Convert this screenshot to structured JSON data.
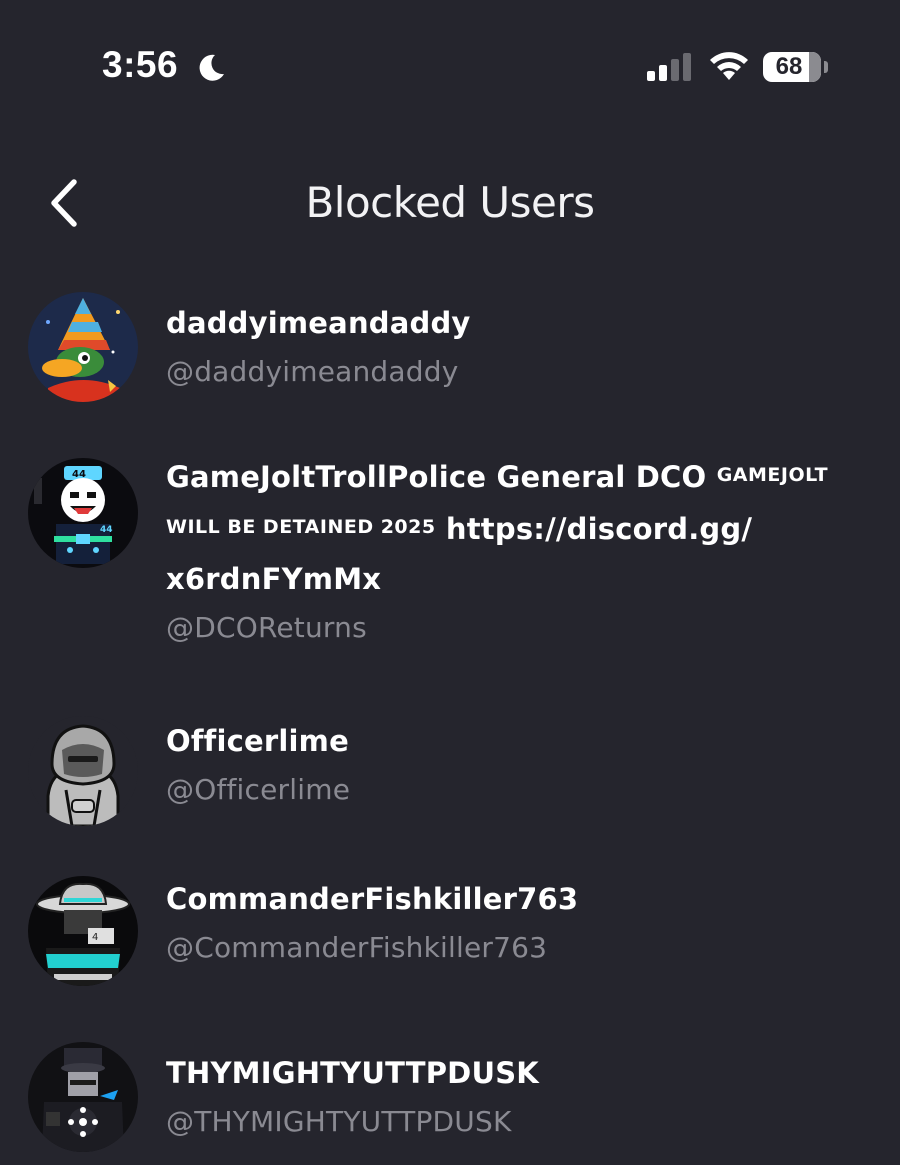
{
  "status_bar": {
    "time": "3:56",
    "focus_icon": "moon-icon",
    "signal_icon": "cellular-signal-icon",
    "wifi_icon": "wifi-icon",
    "battery_level": "68",
    "battery_fraction": 0.68
  },
  "nav": {
    "title": "Blocked Users",
    "back_icon": "chevron-left-icon"
  },
  "users": [
    {
      "display_name": "daddyimeandaddy",
      "handle": "@daddyimeandaddy",
      "avatar_icon": "duck-wizard-avatar"
    },
    {
      "display_name_part1": "GameJoltTrollPolice General DCO ",
      "display_name_part2": "GAMEJOLT WILL BE DETAINED 2025",
      "display_name_part3": " https://discord.gg/",
      "display_name_part4": "x6rdnFYmMx",
      "handle": "@DCOReturns",
      "avatar_icon": "smiley-officer-avatar"
    },
    {
      "display_name": "Officerlime",
      "handle": "@Officerlime",
      "avatar_icon": "hooded-figure-avatar"
    },
    {
      "display_name": "CommanderFishkiller763",
      "handle": "@CommanderFishkiller763",
      "avatar_icon": "cowboy-commander-avatar"
    },
    {
      "display_name": "THYMIGHTYUTTPDUSK",
      "handle": "@THYMIGHTYUTTPDUSK",
      "avatar_icon": "dark-officer-avatar"
    }
  ],
  "colors": {
    "background": "#25252d",
    "primary_text": "#ffffff",
    "secondary_text": "#8a8a92"
  }
}
